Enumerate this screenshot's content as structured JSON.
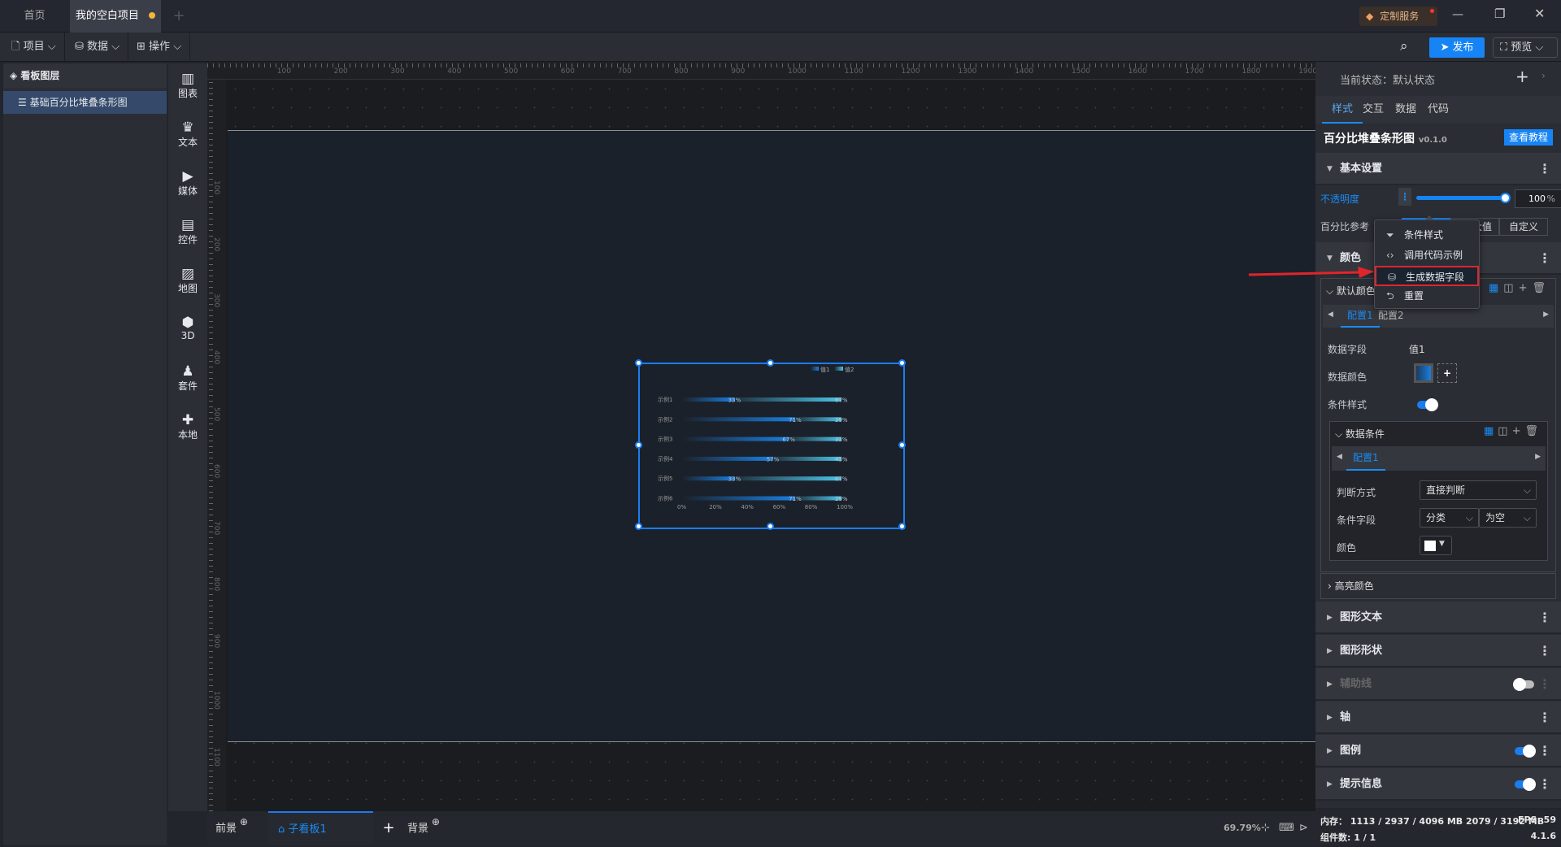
{
  "tabs": {
    "home": "首页",
    "project": "我的空白项目",
    "add": "+"
  },
  "titlebar": {
    "custom_service": "定制服务"
  },
  "toolbar": {
    "project": "项目",
    "data": "数据",
    "operate": "操作",
    "publish": "发布",
    "preview": "预览"
  },
  "layers": {
    "title": "看板图层",
    "items": [
      {
        "label": "基础百分比堆叠条形图"
      }
    ]
  },
  "components": [
    {
      "label": "图表"
    },
    {
      "label": "文本"
    },
    {
      "label": "媒体"
    },
    {
      "label": "控件"
    },
    {
      "label": "地图"
    },
    {
      "label": "3D"
    },
    {
      "label": "套件"
    },
    {
      "label": "本地"
    }
  ],
  "ruler": {
    "top": [
      "100",
      "200",
      "300",
      "400",
      "500",
      "600",
      "700",
      "800",
      "900",
      "1000",
      "1100",
      "1200",
      "1300",
      "1400",
      "1500",
      "1600",
      "1700",
      "1800",
      "1900"
    ],
    "left": [
      "100",
      "200",
      "300",
      "400",
      "500",
      "600",
      "700",
      "800",
      "900",
      "1000",
      "1100"
    ]
  },
  "chart_data": {
    "type": "bar",
    "stacked": true,
    "orientation": "horizontal",
    "categories": [
      "示例1",
      "示例2",
      "示例3",
      "示例4",
      "示例5",
      "示例6"
    ],
    "series": [
      {
        "name": "值1",
        "values": [
          33,
          71,
          67,
          57,
          33,
          71
        ],
        "color": "#1a7fe0"
      },
      {
        "name": "值2",
        "values": [
          67,
          29,
          33,
          43,
          67,
          29
        ],
        "color": "#4cc3e6"
      }
    ],
    "xticks": [
      "0%",
      "20%",
      "40%",
      "60%",
      "80%",
      "100%"
    ],
    "xlim": [
      0,
      100
    ],
    "legend": "top-right",
    "value_labels": true
  },
  "right": {
    "state_label": "当前状态：",
    "state_value": "默认状态",
    "tabs": [
      "样式",
      "交互",
      "数据",
      "代码"
    ],
    "component_title": "百分比堆叠条形图",
    "version": "v0.1.0",
    "tutorial": "查看教程",
    "basic": "基本设置",
    "opacity_label": "不透明度",
    "opacity_value": "100",
    "opacity_unit": "%",
    "percent_ref": "百分比参考",
    "percent_opts": [
      "",
      "最大值",
      "自定义"
    ],
    "color": "颜色",
    "default_color": "默认颜色",
    "configs": [
      "配置1",
      "配置2"
    ],
    "data_field_label": "数据字段",
    "data_field_value": "值1",
    "data_color_label": "数据颜色",
    "cond_style_label": "条件样式",
    "data_cond": "数据条件",
    "cond_configs": [
      "配置1"
    ],
    "judge_label": "判断方式",
    "judge_value": "直接判断",
    "cond_field_label": "条件字段",
    "cond_field_value": "分类",
    "cond_op_value": "为空",
    "cond_color_label": "颜色",
    "highlight": "高亮颜色",
    "sections": [
      "图形文本",
      "图形形状",
      "辅助线",
      "轴",
      "图例",
      "提示信息"
    ]
  },
  "menu": {
    "items": [
      "条件样式",
      "调用代码示例",
      "生成数据字段",
      "重置"
    ]
  },
  "bottom": {
    "front": "前景",
    "sub_board": "子看板1",
    "back": "背景",
    "zoom": "69.79%"
  },
  "status": {
    "memory": "内存：  1113 / 2937 / 4096 MB  2079 / 3192 MB",
    "fps": "FPS:  59",
    "components": "组件数: 1 / 1",
    "version": "4.1.6"
  }
}
